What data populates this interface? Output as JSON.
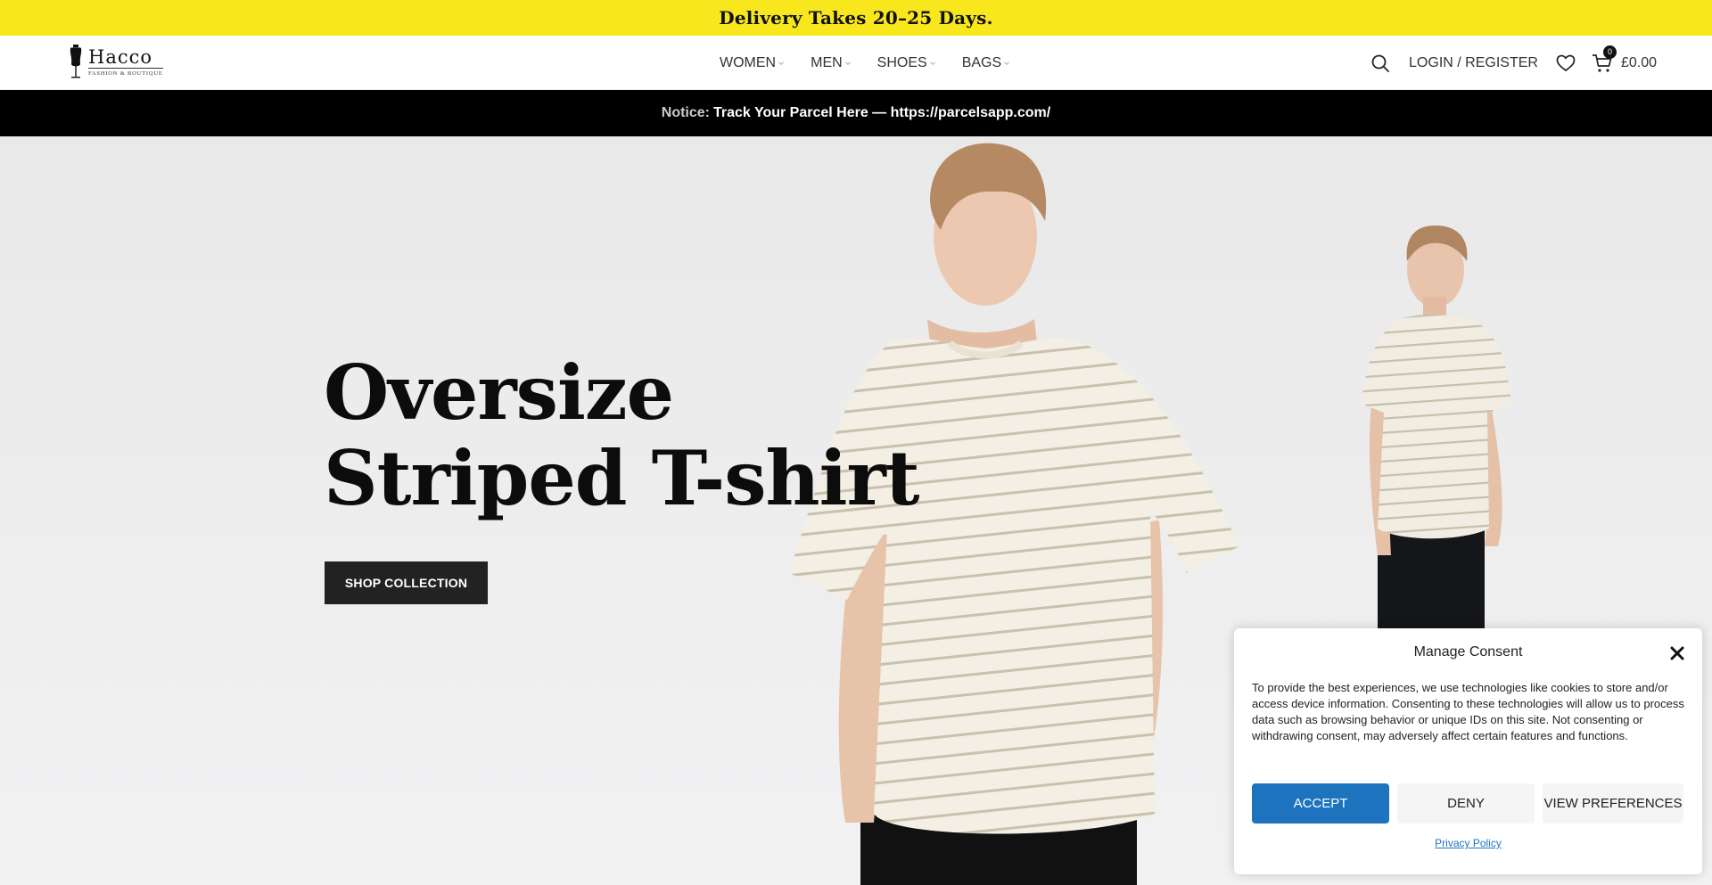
{
  "topbar": {
    "text": "Delivery Takes 20–25 Days."
  },
  "header": {
    "logo": {
      "name": "Hacco",
      "tagline": "FASHION & BOUTIQUE"
    },
    "nav": [
      {
        "label": "WOMEN"
      },
      {
        "label": "MEN"
      },
      {
        "label": "SHOES"
      },
      {
        "label": "BAGS"
      }
    ],
    "login_label": "LOGIN / REGISTER",
    "cart": {
      "count": "0",
      "total": "£0.00"
    }
  },
  "notice": {
    "label": "Notice:",
    "message": "Track Your Parcel Here — https://parcelsapp.com/"
  },
  "hero": {
    "title_line1": "Oversize",
    "title_line2": "Striped T-shirt",
    "cta_label": "SHOP COLLECTION"
  },
  "consent": {
    "title": "Manage Consent",
    "body": "To provide the best experiences, we use technologies like cookies to store and/or access device information. Consenting to these technologies will allow us to process data such as browsing behavior or unique IDs on this site. Not consenting or withdrawing consent, may adversely affect certain features and functions.",
    "accept_label": "ACCEPT",
    "deny_label": "DENY",
    "prefs_label": "VIEW PREFERENCES",
    "privacy_label": "Privacy Policy"
  },
  "colors": {
    "banner_yellow": "#f8e71c",
    "notice_bg": "#000000",
    "accept_blue": "#1e73be",
    "button_dark": "#222222"
  },
  "icons": [
    "dress-form-icon",
    "chevron-down-icon",
    "search-icon",
    "heart-icon",
    "cart-icon",
    "close-icon"
  ]
}
